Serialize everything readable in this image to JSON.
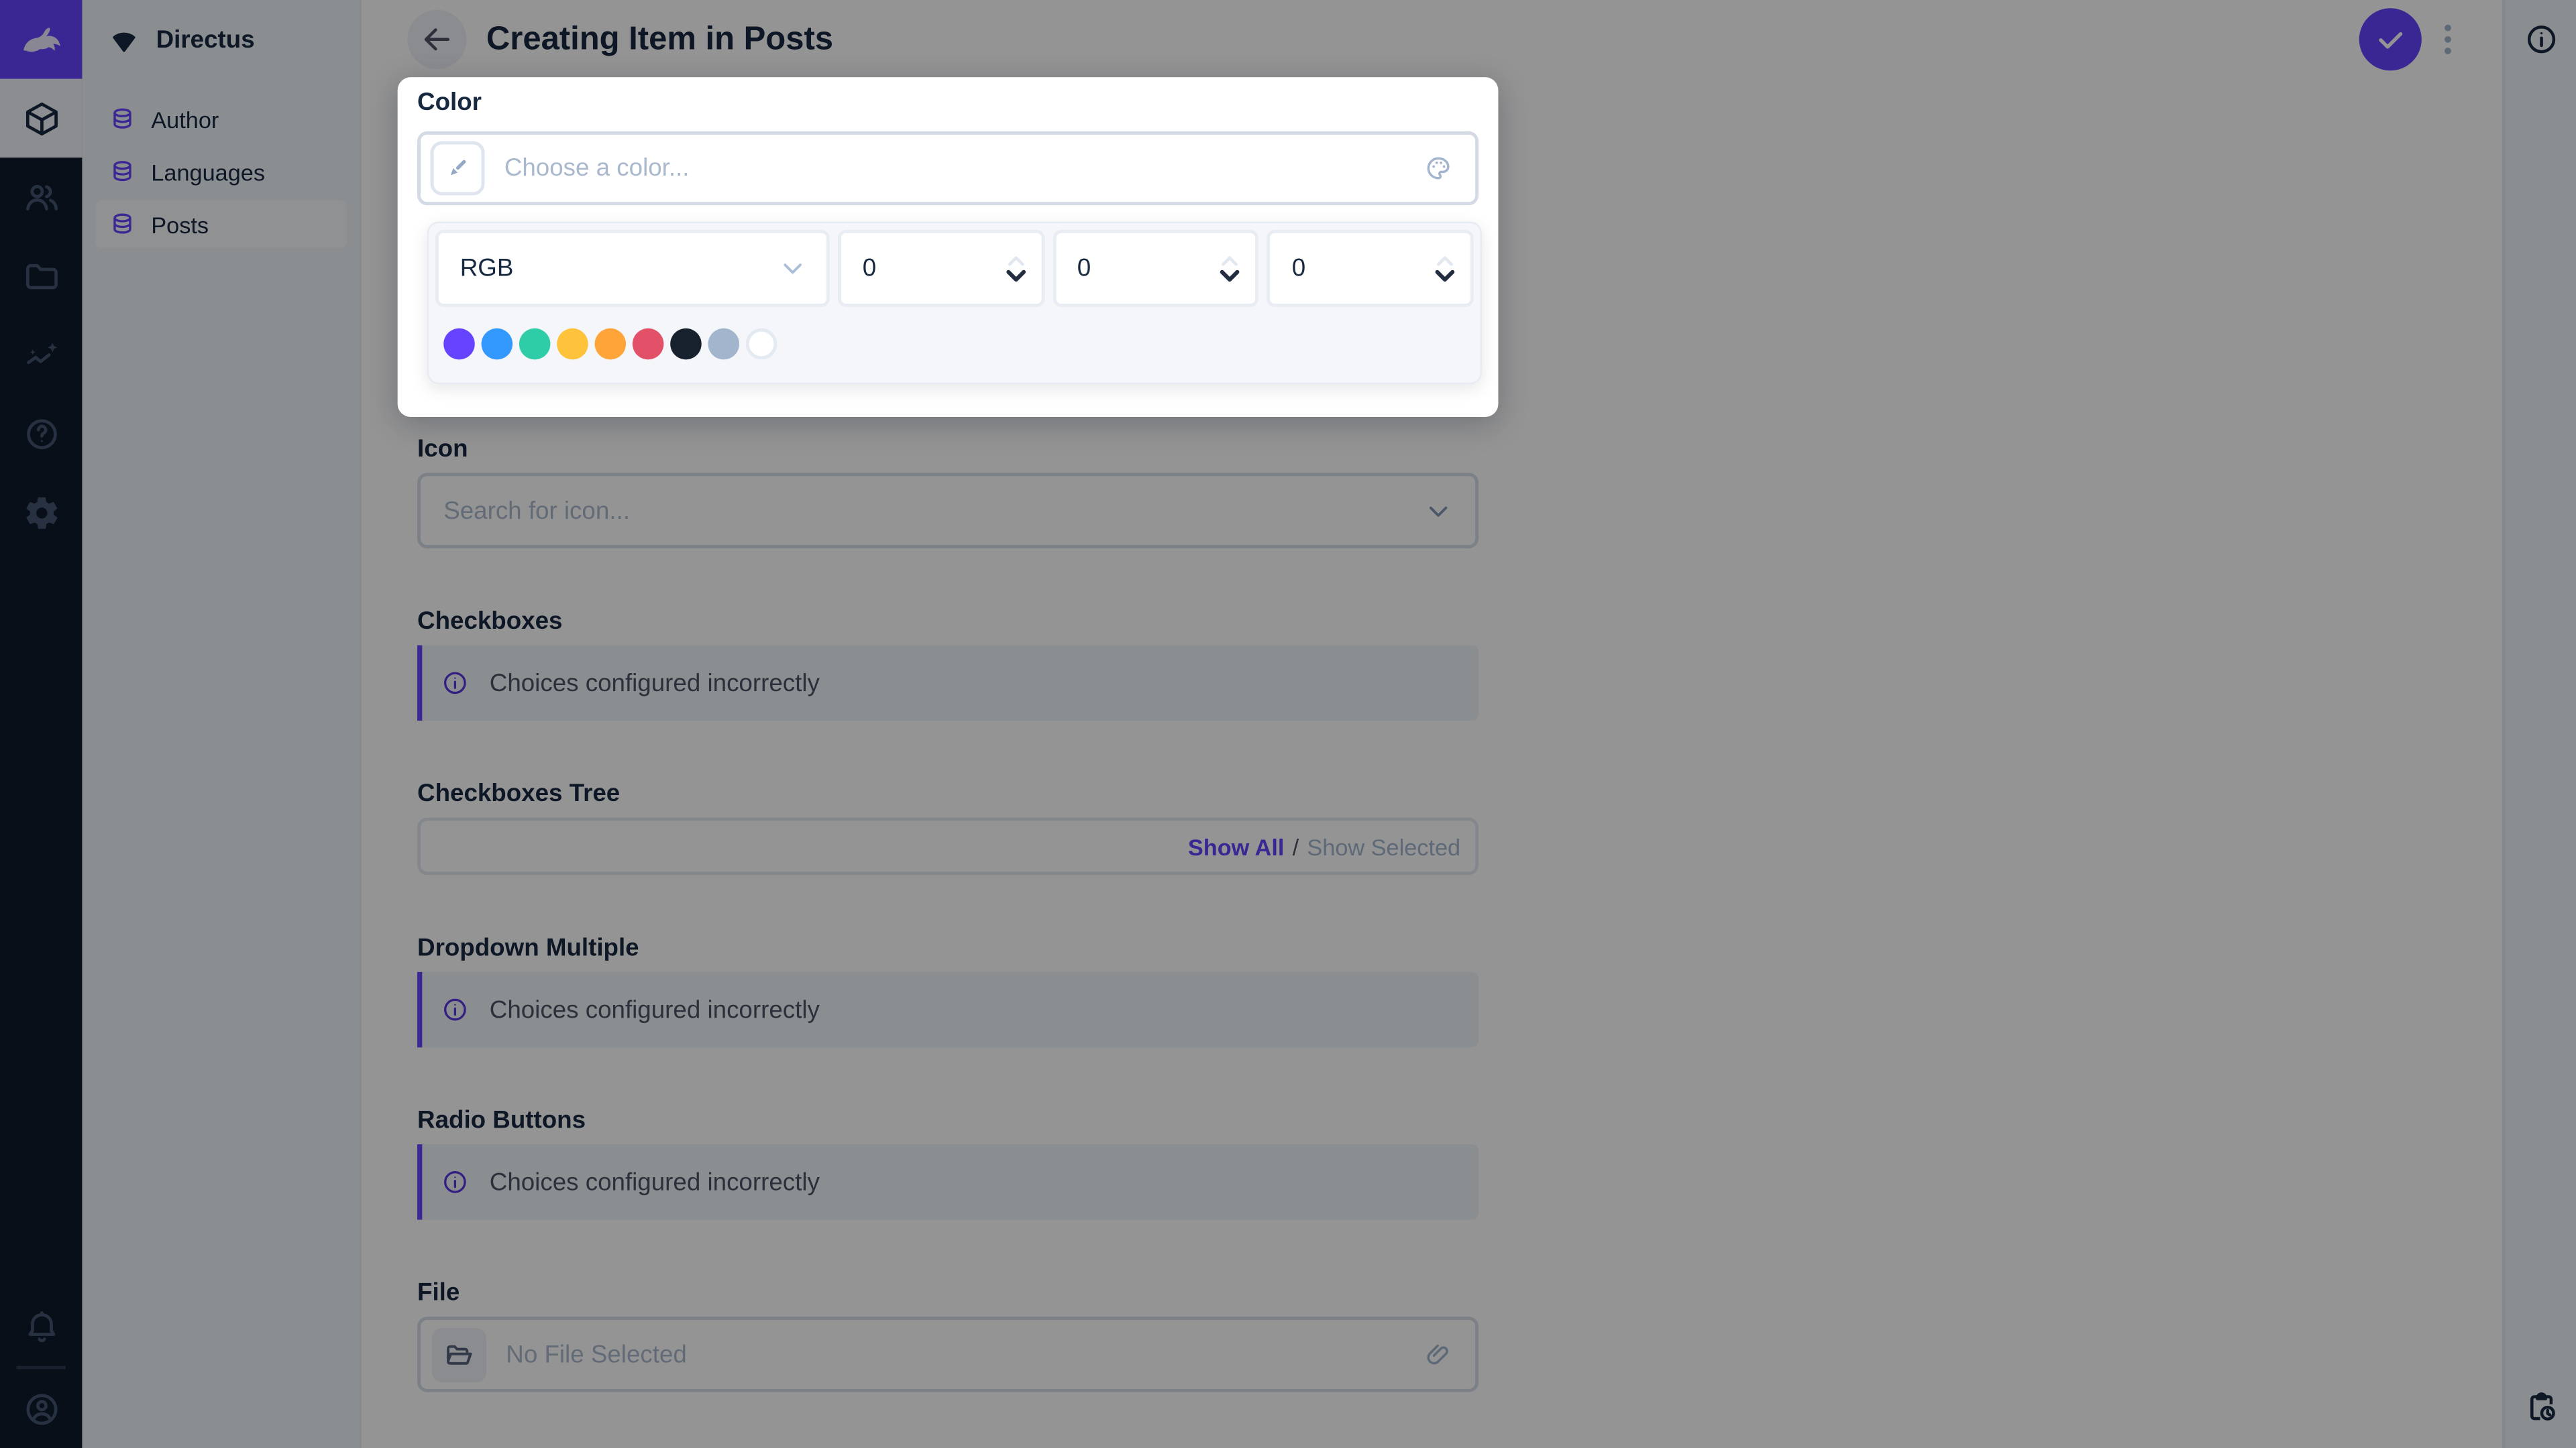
{
  "app": {
    "project_name": "Directus"
  },
  "module_bar": {
    "modules": [
      "content",
      "users",
      "files",
      "insights",
      "help",
      "settings"
    ],
    "bottom": [
      "notifications",
      "account"
    ]
  },
  "nav": {
    "items": [
      {
        "label": "Author",
        "active": false
      },
      {
        "label": "Languages",
        "active": false
      },
      {
        "label": "Posts",
        "active": true
      }
    ]
  },
  "header": {
    "title": "Creating Item in Posts"
  },
  "color_popup": {
    "label": "Color",
    "placeholder": "Choose a color...",
    "mode": "RGB",
    "channels": [
      "0",
      "0",
      "0"
    ],
    "swatches": [
      "#6644FF",
      "#3399FF",
      "#2ECDA7",
      "#FFC23B",
      "#FFA439",
      "#E35169",
      "#18222F",
      "#A2B5CD",
      "#FFFFFF"
    ]
  },
  "fields": {
    "icon": {
      "label": "Icon",
      "placeholder": "Search for icon..."
    },
    "checkboxes": {
      "label": "Checkboxes",
      "notice": "Choices configured incorrectly"
    },
    "checkboxes_tree": {
      "label": "Checkboxes Tree",
      "show_all": "Show All",
      "separator": "/",
      "show_selected": "Show Selected"
    },
    "dropdown_multiple": {
      "label": "Dropdown Multiple",
      "notice": "Choices configured incorrectly"
    },
    "radio_buttons": {
      "label": "Radio Buttons",
      "notice": "Choices configured incorrectly"
    },
    "file": {
      "label": "File",
      "placeholder": "No File Selected"
    }
  },
  "colors": {
    "accent": "#6644FF",
    "module_bar_background": "#0e1a2b",
    "sidebar_background": "#f0f4f9",
    "text_primary": "#172940",
    "text_subdued": "#a2b5cd",
    "border": "#d3dae4",
    "overlay": "rgba(0,0,0,0.42)"
  },
  "icons": {
    "logo": "directus-rabbit",
    "project": "fan-diamond",
    "collection": "database-cylinder",
    "popup": [
      "eyedropper",
      "palette",
      "chevron-down",
      "stepper-arrows"
    ],
    "fields": [
      "chevron-down",
      "info-circle",
      "folder-open",
      "paperclip"
    ],
    "header": [
      "arrow-left",
      "check",
      "dots-vertical",
      "info-circle"
    ],
    "right_bar": [
      "info-circle",
      "clipboard-clock"
    ]
  }
}
